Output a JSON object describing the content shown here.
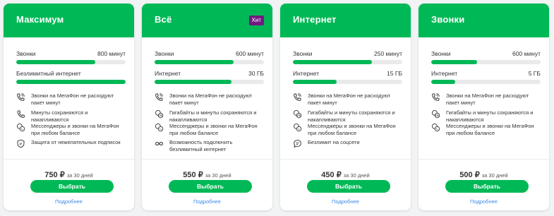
{
  "tariffs": [
    {
      "title": "Максимум",
      "badge": "",
      "meters": [
        {
          "label": "Звонки",
          "value": "800 минут",
          "fill_pct": 72
        },
        {
          "label": "Безлимитный интернет",
          "value": "",
          "fill_pct": 100
        }
      ],
      "features": [
        {
          "icon": "phone-wifi-icon",
          "text": "Звонки на МегаФон не расходуют пакет минут"
        },
        {
          "icon": "phone-icon",
          "text": "Минуты сохраняются и накапливаются"
        },
        {
          "icon": "messenger-icon",
          "text": "Мессенджеры и звонки на МегаФон при любом балансе"
        },
        {
          "icon": "shield-icon",
          "text": "Защита от нежелательных подписок"
        }
      ],
      "price": "750 ₽",
      "period": "за 30 дней",
      "button": "Выбрать",
      "more": "Подробнее"
    },
    {
      "title": "Всё",
      "badge": "Хит",
      "meters": [
        {
          "label": "Звонки",
          "value": "600 минут",
          "fill_pct": 72
        },
        {
          "label": "Интернет",
          "value": "30 ГБ",
          "fill_pct": 70
        }
      ],
      "features": [
        {
          "icon": "phone-wifi-icon",
          "text": "Звонки на МегаФон не расходуют пакет минут"
        },
        {
          "icon": "gb-icon",
          "text": "Гигабайты и минуты сохраняются и накапливаются"
        },
        {
          "icon": "messenger-icon",
          "text": "Мессенджеры и звонки на МегаФон при любом балансе"
        },
        {
          "icon": "infinity-icon",
          "text": "Возможность подключить безлимитный интернет"
        }
      ],
      "price": "550 ₽",
      "period": "за 30 дней",
      "button": "Выбрать",
      "more": "Подробнее"
    },
    {
      "title": "Интернет",
      "badge": "",
      "meters": [
        {
          "label": "Звонки",
          "value": "250 минут",
          "fill_pct": 72
        },
        {
          "label": "Интернет",
          "value": "15 ГБ",
          "fill_pct": 40
        }
      ],
      "features": [
        {
          "icon": "phone-wifi-icon",
          "text": "Звонки на МегаФон не расходуют пакет минут"
        },
        {
          "icon": "gb-icon",
          "text": "Гигабайты и минуты сохраняются и накапливаются"
        },
        {
          "icon": "messenger-icon",
          "text": "Мессенджеры и звонки на МегаФон при любом балансе"
        },
        {
          "icon": "chat-icon",
          "text": "Безлимит на соцсети"
        }
      ],
      "price": "450 ₽",
      "period": "за 30 дней",
      "button": "Выбрать",
      "more": "Подробнее"
    },
    {
      "title": "Звонки",
      "badge": "",
      "meters": [
        {
          "label": "Звонки",
          "value": "600 минут",
          "fill_pct": 42
        },
        {
          "label": "Интернет",
          "value": "5 ГБ",
          "fill_pct": 22
        }
      ],
      "features": [
        {
          "icon": "phone-wifi-icon",
          "text": "Звонки на МегаФон не расходуют пакет минут"
        },
        {
          "icon": "gb-icon",
          "text": "Гигабайты и минуты сохраняются и накапливаются"
        },
        {
          "icon": "messenger-icon",
          "text": "Мессенджеры и звонки на МегаФон при любом балансе"
        }
      ],
      "price": "500 ₽",
      "period": "за 30 дней",
      "button": "Выбрать",
      "more": "Подробнее"
    }
  ],
  "colors": {
    "brand_green": "#00b956",
    "hit_purple": "#731982",
    "link_blue": "#3c8ce7"
  }
}
